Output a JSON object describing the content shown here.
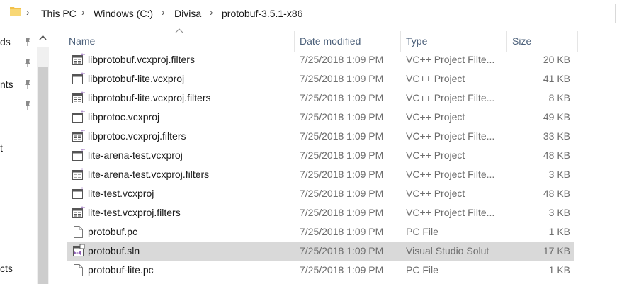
{
  "breadcrumb": [
    "This PC",
    "Windows (C:)",
    "Divisa",
    "protobuf-3.5.1-x86"
  ],
  "nav": {
    "items": [
      "ds",
      "nts",
      "t",
      "cts"
    ]
  },
  "columns": {
    "name": "Name",
    "date": "Date modified",
    "type": "Type",
    "size": "Size"
  },
  "files": [
    {
      "name": "libprotobuf.vcxproj.filters",
      "date": "7/25/2018 1:09 PM",
      "type": "VC++ Project Filte...",
      "size": "20 KB",
      "icon": "vcxproj-filters-icon"
    },
    {
      "name": "libprotobuf-lite.vcxproj",
      "date": "7/25/2018 1:09 PM",
      "type": "VC++ Project",
      "size": "41 KB",
      "icon": "vcxproj-icon"
    },
    {
      "name": "libprotobuf-lite.vcxproj.filters",
      "date": "7/25/2018 1:09 PM",
      "type": "VC++ Project Filte...",
      "size": "8 KB",
      "icon": "vcxproj-filters-icon"
    },
    {
      "name": "libprotoc.vcxproj",
      "date": "7/25/2018 1:09 PM",
      "type": "VC++ Project",
      "size": "49 KB",
      "icon": "vcxproj-icon"
    },
    {
      "name": "libprotoc.vcxproj.filters",
      "date": "7/25/2018 1:09 PM",
      "type": "VC++ Project Filte...",
      "size": "33 KB",
      "icon": "vcxproj-filters-icon"
    },
    {
      "name": "lite-arena-test.vcxproj",
      "date": "7/25/2018 1:09 PM",
      "type": "VC++ Project",
      "size": "48 KB",
      "icon": "vcxproj-icon"
    },
    {
      "name": "lite-arena-test.vcxproj.filters",
      "date": "7/25/2018 1:09 PM",
      "type": "VC++ Project Filte...",
      "size": "3 KB",
      "icon": "vcxproj-filters-icon"
    },
    {
      "name": "lite-test.vcxproj",
      "date": "7/25/2018 1:09 PM",
      "type": "VC++ Project",
      "size": "48 KB",
      "icon": "vcxproj-icon"
    },
    {
      "name": "lite-test.vcxproj.filters",
      "date": "7/25/2018 1:09 PM",
      "type": "VC++ Project Filte...",
      "size": "3 KB",
      "icon": "vcxproj-filters-icon"
    },
    {
      "name": "protobuf.pc",
      "date": "7/25/2018 1:09 PM",
      "type": "PC File",
      "size": "1 KB",
      "icon": "file-icon"
    },
    {
      "name": "protobuf.sln",
      "date": "7/25/2018 1:09 PM",
      "type": "Visual Studio Solut",
      "size": "17 KB",
      "icon": "sln-icon",
      "selected": true
    },
    {
      "name": "protobuf-lite.pc",
      "date": "7/25/2018 1:09 PM",
      "type": "PC File",
      "size": "1 KB",
      "icon": "file-icon"
    }
  ],
  "colors": {
    "selected_row": "#d9d9d9",
    "header_text": "#4c607a",
    "vcx_accent": "#8e5db5"
  }
}
